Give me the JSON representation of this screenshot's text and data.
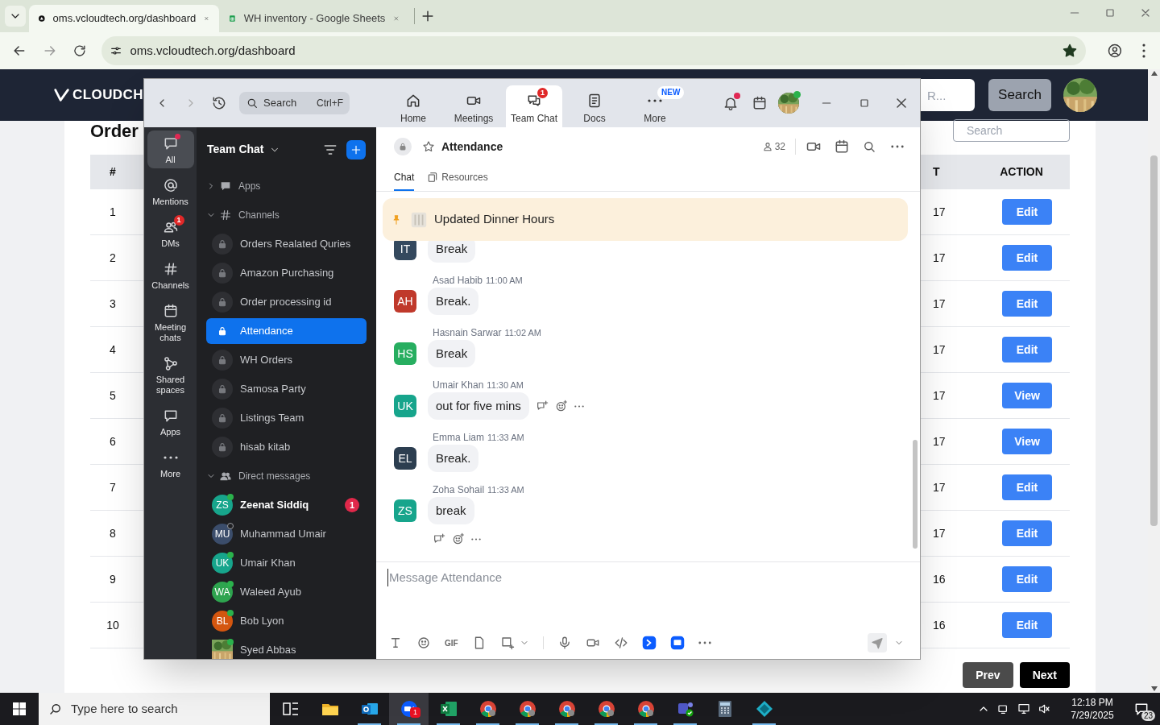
{
  "browser": {
    "tabs": [
      {
        "title": "oms.vcloudtech.org/dashboard",
        "kind": "site",
        "selected": true
      },
      {
        "title": "WH inventory - Google Sheets",
        "kind": "sheet",
        "selected": false
      }
    ],
    "address": "oms.vcloudtech.org/dashboard"
  },
  "page": {
    "logo": "CLOUDCH",
    "header_search": {
      "placeholder": "R..."
    },
    "header_button": "Search",
    "heading": "Order",
    "filter_search": {
      "placeholder": "Search"
    },
    "table": {
      "columns": [
        "#",
        "T",
        "ACTION"
      ],
      "rows": [
        {
          "number": "1",
          "column_2": "17",
          "action": "Edit"
        },
        {
          "number": "2",
          "column_2": "17",
          "action": "Edit"
        },
        {
          "number": "3",
          "column_2": "17",
          "action": "Edit"
        },
        {
          "number": "4",
          "column_2": "17",
          "action": "Edit"
        },
        {
          "number": "5",
          "column_2": "17",
          "action": "View"
        },
        {
          "number": "6",
          "column_2": "17",
          "action": "View"
        },
        {
          "number": "7",
          "column_2": "17",
          "action": "Edit"
        },
        {
          "number": "8",
          "column_2": "17",
          "action": "Edit"
        },
        {
          "number": "9",
          "column_2": "16",
          "action": "Edit"
        },
        {
          "number": "10",
          "column_2": "16",
          "action": "Edit"
        }
      ]
    },
    "pagination": [
      {
        "label": "Prev",
        "disabled": true
      },
      {
        "label": "Next",
        "disabled": false
      }
    ]
  },
  "zoom": {
    "search": {
      "placeholder": "Search",
      "shortcut": "Ctrl+F"
    },
    "nav": [
      {
        "label": "Home",
        "selected": false
      },
      {
        "label": "Meetings",
        "selected": false
      },
      {
        "label": "Team Chat",
        "selected": true,
        "badge": {
          "kind": "count",
          "text": "1"
        }
      },
      {
        "label": "Docs",
        "selected": false
      },
      {
        "label": "More",
        "selected": false,
        "badge": {
          "kind": "new",
          "text": "NEW"
        }
      }
    ],
    "notifications_unread": true,
    "profile_online": true,
    "rail": [
      {
        "label": "All",
        "selected": true,
        "unread_dot": true
      },
      {
        "label": "Mentions",
        "selected": false
      },
      {
        "label": "DMs",
        "selected": false,
        "badge": "1"
      },
      {
        "label": "Channels",
        "selected": false
      },
      {
        "label": "Meeting chats",
        "selected": false
      },
      {
        "label": "Shared spaces",
        "selected": false
      },
      {
        "label": "Apps",
        "selected": false
      },
      {
        "label": "More",
        "selected": false
      }
    ],
    "sidebar": {
      "title": "Team Chat",
      "sections": [
        {
          "kind": "apps",
          "label": "Apps",
          "expanded": false
        },
        {
          "kind": "channels",
          "label": "Channels",
          "expanded": true,
          "children": [
            {
              "name": "Orders Realated Quries",
              "selected": false
            },
            {
              "name": "Amazon Purchasing",
              "selected": false
            },
            {
              "name": "Order processing id",
              "selected": false
            },
            {
              "name": "Attendance",
              "selected": true
            },
            {
              "name": "WH Orders",
              "selected": false
            },
            {
              "name": "Samosa Party",
              "selected": false
            },
            {
              "name": "Listings Team",
              "selected": false
            },
            {
              "name": "hisab kitab",
              "selected": false
            }
          ]
        },
        {
          "kind": "people",
          "label": "Direct messages",
          "expanded": true,
          "children": [
            {
              "kind": "initials",
              "initials": "ZS",
              "name": "Zeenat Siddiq",
              "color": "#17a58c",
              "online": true,
              "unread": "1",
              "selected": false
            },
            {
              "kind": "initials",
              "initials": "MU",
              "name": "Muhammad Umair",
              "color": "#3b4d6b",
              "online": false,
              "selected": false
            },
            {
              "kind": "initials",
              "initials": "UK",
              "name": "Umair Khan",
              "color": "#17a58c",
              "online": true,
              "selected": false
            },
            {
              "kind": "initials",
              "initials": "WA",
              "name": "Waleed Ayub",
              "color": "#2ea44f",
              "online": true,
              "selected": false
            },
            {
              "kind": "initials",
              "initials": "BL",
              "name": "Bob Lyon",
              "color": "#d4560f",
              "online": true,
              "selected": false
            },
            {
              "kind": "picture",
              "name": "Syed Abbas",
              "online": true,
              "selected": false
            }
          ]
        }
      ]
    },
    "chat": {
      "title": "Attendance",
      "starred": false,
      "members": "32",
      "tabs": [
        {
          "label": "Chat",
          "selected": true
        },
        {
          "label": "Resources",
          "selected": false
        }
      ],
      "pinned": "Updated Dinner Hours",
      "messages": [
        {
          "kind": "plain",
          "initials": "IT",
          "color": "#34495e",
          "text": "Break"
        },
        {
          "kind": "plain",
          "sender": "Asad Habib",
          "time": "11:00 AM",
          "initials": "AH",
          "color": "#c0392b",
          "text": "Break."
        },
        {
          "kind": "plain",
          "sender": "Hasnain Sarwar",
          "time": "11:02 AM",
          "initials": "HS",
          "color": "#27ae60",
          "text": "Break"
        },
        {
          "kind": "actions-inline",
          "sender": "Umair Khan",
          "time": "11:30 AM",
          "initials": "UK",
          "color": "#17a58c",
          "text": "out for five mins"
        },
        {
          "kind": "plain",
          "sender": "Emma Liam",
          "time": "11:33 AM",
          "initials": "EL",
          "color": "#2c3e50",
          "text": "Break."
        },
        {
          "kind": "actions-below",
          "sender": "Zoha Sohail",
          "time": "11:33 AM",
          "initials": "ZS",
          "color": "#17a58c",
          "text": "break"
        }
      ],
      "composer": {
        "placeholder": "Message Attendance",
        "gif": "GIF"
      }
    }
  },
  "taskbar": {
    "search_placeholder": "Type here to search",
    "apps": [
      {
        "kind": "taskview",
        "active": false,
        "running": false
      },
      {
        "kind": "folder",
        "active": false,
        "running": false
      },
      {
        "kind": "mail",
        "active": false,
        "running": true
      },
      {
        "kind": "video",
        "active": true,
        "running": true,
        "badge": "1"
      },
      {
        "kind": "sheet",
        "active": false,
        "running": true
      },
      {
        "kind": "browser",
        "active": false,
        "running": true
      },
      {
        "kind": "browser",
        "active": false,
        "running": true
      },
      {
        "kind": "browser",
        "active": false,
        "running": true
      },
      {
        "kind": "browser",
        "active": false,
        "running": true
      },
      {
        "kind": "browser",
        "active": false,
        "running": true
      },
      {
        "kind": "team",
        "active": false,
        "running": true
      },
      {
        "kind": "calculator",
        "active": false,
        "running": false
      },
      {
        "kind": "diamond",
        "active": false,
        "running": true
      }
    ],
    "time": "12:18 PM",
    "date": "7/29/2025",
    "notifications": "23"
  }
}
